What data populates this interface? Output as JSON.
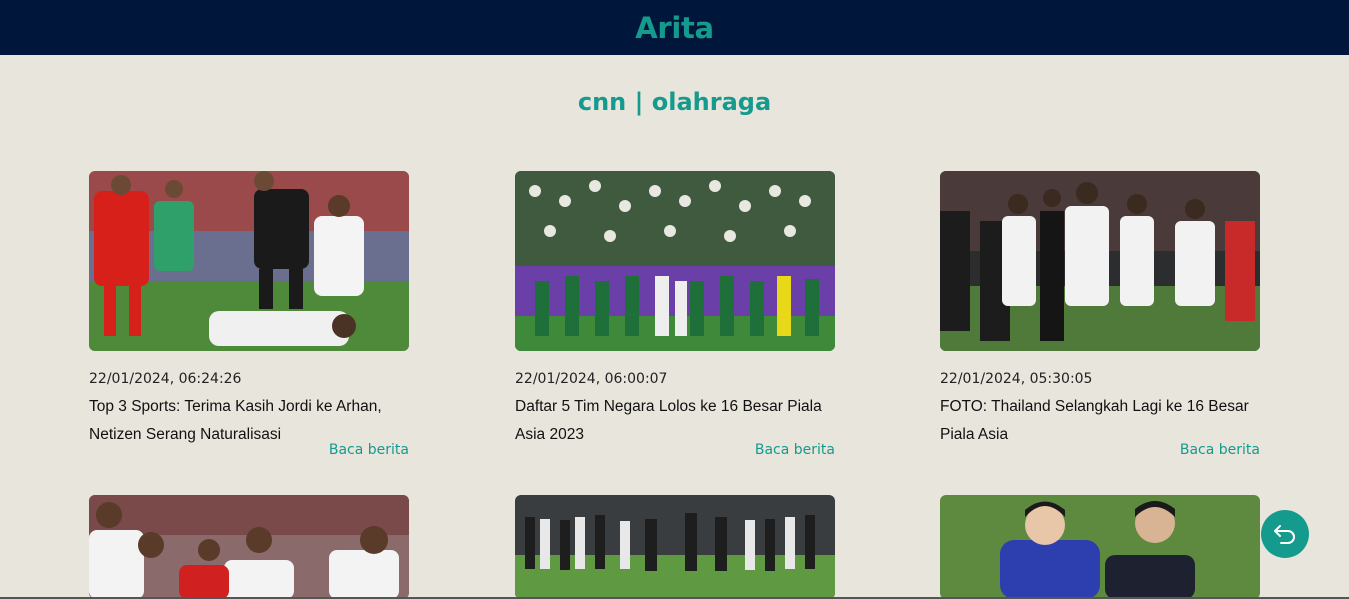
{
  "header": {
    "brand": "Arita"
  },
  "section": {
    "title": "cnn | olahraga"
  },
  "articles": [
    {
      "date": "22/01/2024, 06:24:26",
      "title": "Top 3 Sports: Terima Kasih Jordi ke Arhan, Netizen Serang Naturalisasi",
      "link": "Baca berita"
    },
    {
      "date": "22/01/2024, 06:00:07",
      "title": "Daftar 5 Tim Negara Lolos ke 16 Besar Piala Asia 2023",
      "link": "Baca berita"
    },
    {
      "date": "22/01/2024, 05:30:05",
      "title": "FOTO: Thailand Selangkah Lagi ke 16 Besar Piala Asia",
      "link": "Baca berita"
    }
  ],
  "colors": {
    "accent": "#159a8e",
    "header_bg": "#00163a",
    "page_bg": "#e8e5dc"
  },
  "icons": {
    "back": "back-arrow-icon"
  }
}
